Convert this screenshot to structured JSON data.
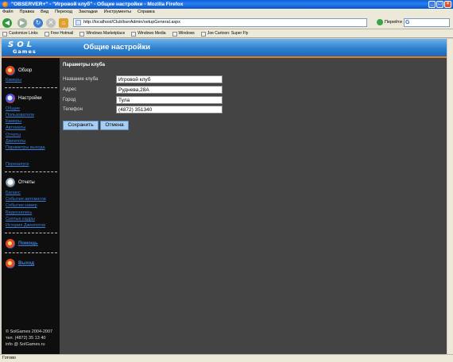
{
  "window": {
    "title": "\"OBSERVER+\" - \"Игровой клуб\" - Общие настройки - Mozilla Firefox"
  },
  "menu": [
    "Файл",
    "Правка",
    "Вид",
    "Переход",
    "Закладки",
    "Инструменты",
    "Справка"
  ],
  "toolbar": {
    "url": "http://localhost/ClubIlserAdmin/setupGeneral.aspx",
    "go_label": "Перейти"
  },
  "bookmarks": [
    "Customize Links",
    "Free Hotmail",
    "Windows Marketplace",
    "Windows Media",
    "Windows",
    "Joe Cartoon: Super Fly"
  ],
  "header": {
    "logo_top": "SOL",
    "logo_bottom": "Games",
    "page_title": "Общие настройки"
  },
  "sidebar": {
    "overview": {
      "title": "Обзор",
      "links": [
        "Камеры"
      ]
    },
    "settings": {
      "title": "Настройки",
      "links": [
        "Общие",
        "Пользователи",
        "Камеры",
        "Автоматы",
        "Отчеты",
        "Джекпоты",
        "Параметры выхода"
      ]
    },
    "restart": "Перезапуск",
    "reports": {
      "title": "Отчеты",
      "links": [
        "Баланс",
        "События автоматов",
        "События камер",
        "Видеозапись",
        "Снятые кадры",
        "История Джекпотов"
      ]
    },
    "help": "Помощь",
    "exit": "Выход",
    "footer": [
      "© SolGames 2004-2007",
      "тел. (4872) 35 13 40",
      "info @ SolGames.ru"
    ]
  },
  "content": {
    "section_title": "Параметры клуба",
    "fields": [
      {
        "label": "Название клуба",
        "value": "Игровой клуб"
      },
      {
        "label": "Адрес",
        "value": "Руднева,28А"
      },
      {
        "label": "Город",
        "value": "Тула"
      },
      {
        "label": "Телефон",
        "value": "(4872) 351340"
      }
    ],
    "save_label": "Сохранить",
    "cancel_label": "Отмена"
  },
  "status": "Готово"
}
